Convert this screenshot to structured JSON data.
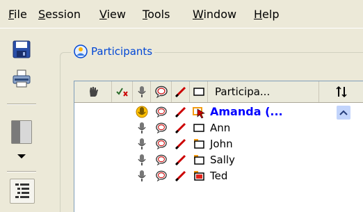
{
  "menu": {
    "items": [
      {
        "label_ul": "F",
        "label_rest": "ile"
      },
      {
        "label_ul": "S",
        "label_rest": "ession"
      },
      {
        "label_ul": "V",
        "label_rest": "iew"
      },
      {
        "label_ul": "T",
        "label_rest": "ools"
      },
      {
        "label_ul": "W",
        "label_rest": "indow"
      },
      {
        "label_ul": "H",
        "label_rest": "elp"
      }
    ]
  },
  "toolbar": {
    "buttons": [
      "save-icon",
      "print-icon",
      "layout-split-icon",
      "dropdown-arrow-icon",
      "list-icon"
    ]
  },
  "participants_panel": {
    "title": "Participants",
    "columns": {
      "name_header": "Participa...",
      "sort_icon": "sort-icon"
    },
    "rows": [
      {
        "name": "Amanda (...",
        "bold": true,
        "mic_active": true,
        "status_icon": "presenter-cursor-icon"
      },
      {
        "name": "Ann",
        "bold": false,
        "mic_active": false,
        "status_icon": "window-icon"
      },
      {
        "name": "John",
        "bold": false,
        "mic_active": false,
        "status_icon": "window-orange-icon"
      },
      {
        "name": "Sally",
        "bold": false,
        "mic_active": false,
        "status_icon": "window-orange-icon"
      },
      {
        "name": "Ted",
        "bold": false,
        "mic_active": false,
        "status_icon": "window-red-icon"
      }
    ]
  },
  "colors": {
    "accent": "#0046d5",
    "name_bold": "#0000ff"
  }
}
